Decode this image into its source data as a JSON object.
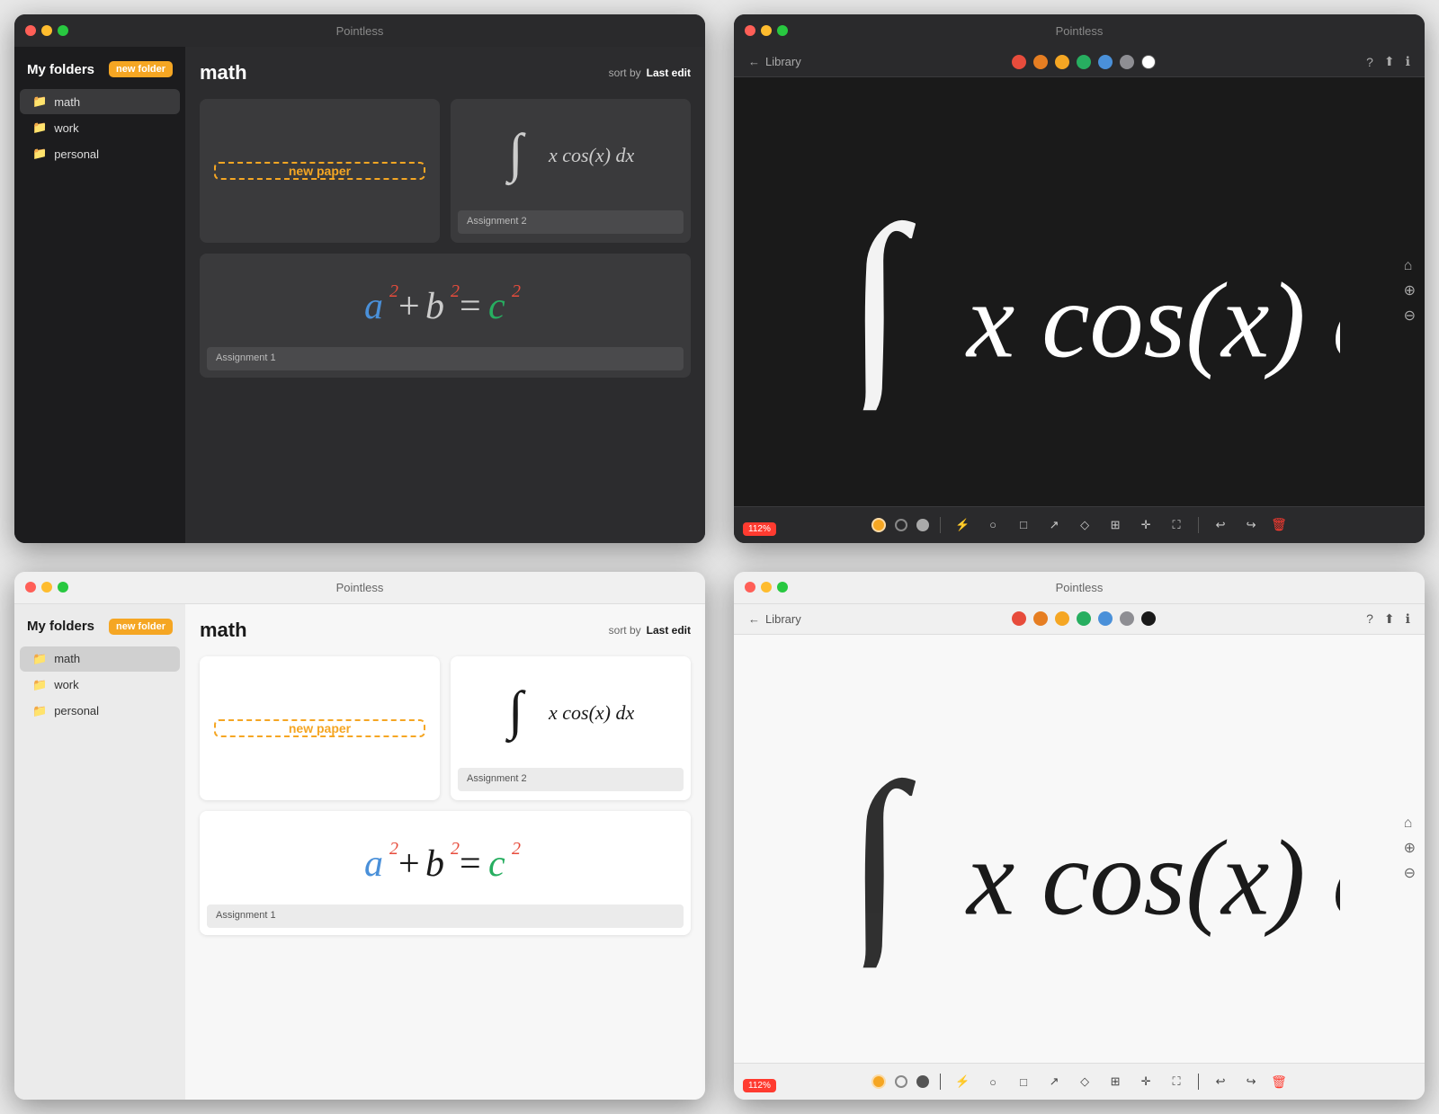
{
  "app": {
    "name": "Pointless"
  },
  "windows": {
    "top_left": {
      "type": "folder",
      "theme": "dark",
      "titlebar": {
        "title": "Pointless"
      },
      "sidebar": {
        "title": "My folders",
        "new_folder_label": "new folder",
        "items": [
          {
            "id": "math",
            "label": "math",
            "active": true
          },
          {
            "id": "work",
            "label": "work",
            "active": false
          },
          {
            "id": "personal",
            "label": "personal",
            "active": false
          }
        ]
      },
      "main": {
        "title": "math",
        "sort_label": "sort by",
        "sort_value": "Last edit",
        "papers": [
          {
            "id": "new",
            "type": "new",
            "label": "new paper"
          },
          {
            "id": "assignment2",
            "type": "formula_integral",
            "label": "Assignment 2"
          },
          {
            "id": "assignment1",
            "type": "formula_pyth",
            "label": "Assignment 1"
          }
        ]
      }
    },
    "top_right": {
      "type": "canvas",
      "theme": "dark",
      "titlebar": {
        "title": "Pointless"
      },
      "toolbar_top": {
        "back_label": "Library",
        "colors": [
          "#e74c3c",
          "#e67e22",
          "#f5a623",
          "#27ae60",
          "#4a90d9",
          "#8e8e93",
          "#ffffff"
        ],
        "icons": [
          "help",
          "download",
          "info"
        ]
      },
      "canvas": {
        "formula_display": "∫ x cos(x) dx"
      },
      "toolbar_bottom": {
        "zoom": "112%",
        "tools": [
          "dot-orange",
          "dot-white",
          "dot-dark",
          "lightning",
          "circle-outline",
          "square-outline",
          "arrow",
          "eraser",
          "grid",
          "move",
          "fullscreen",
          "undo",
          "redo"
        ]
      }
    },
    "bottom_left": {
      "type": "folder",
      "theme": "light",
      "titlebar": {
        "title": "Pointless"
      },
      "sidebar": {
        "title": "My folders",
        "new_folder_label": "new folder",
        "items": [
          {
            "id": "math",
            "label": "math",
            "active": true
          },
          {
            "id": "work",
            "label": "work",
            "active": false
          },
          {
            "id": "personal",
            "label": "personal",
            "active": false
          }
        ]
      },
      "main": {
        "title": "math",
        "sort_label": "sort by",
        "sort_value": "Last edit",
        "papers": [
          {
            "id": "new",
            "type": "new",
            "label": "new paper"
          },
          {
            "id": "assignment2",
            "type": "formula_integral",
            "label": "Assignment 2"
          },
          {
            "id": "assignment1",
            "type": "formula_pyth",
            "label": "Assignment 1"
          }
        ]
      }
    },
    "bottom_right": {
      "type": "canvas",
      "theme": "light",
      "titlebar": {
        "title": "Pointless"
      },
      "toolbar_top": {
        "back_label": "Library",
        "colors": [
          "#e74c3c",
          "#e67e22",
          "#f5a623",
          "#27ae60",
          "#4a90d9",
          "#8e8e93",
          "#1a1a1a"
        ],
        "icons": [
          "help",
          "download",
          "info"
        ]
      },
      "canvas": {
        "formula_display": "∫ x cos(x) dx"
      },
      "toolbar_bottom": {
        "zoom": "112%",
        "tools": [
          "dot-orange",
          "dot-white",
          "dot-dark",
          "lightning",
          "circle-outline",
          "square-outline",
          "arrow",
          "eraser",
          "grid",
          "move",
          "fullscreen",
          "undo",
          "redo"
        ]
      }
    }
  }
}
